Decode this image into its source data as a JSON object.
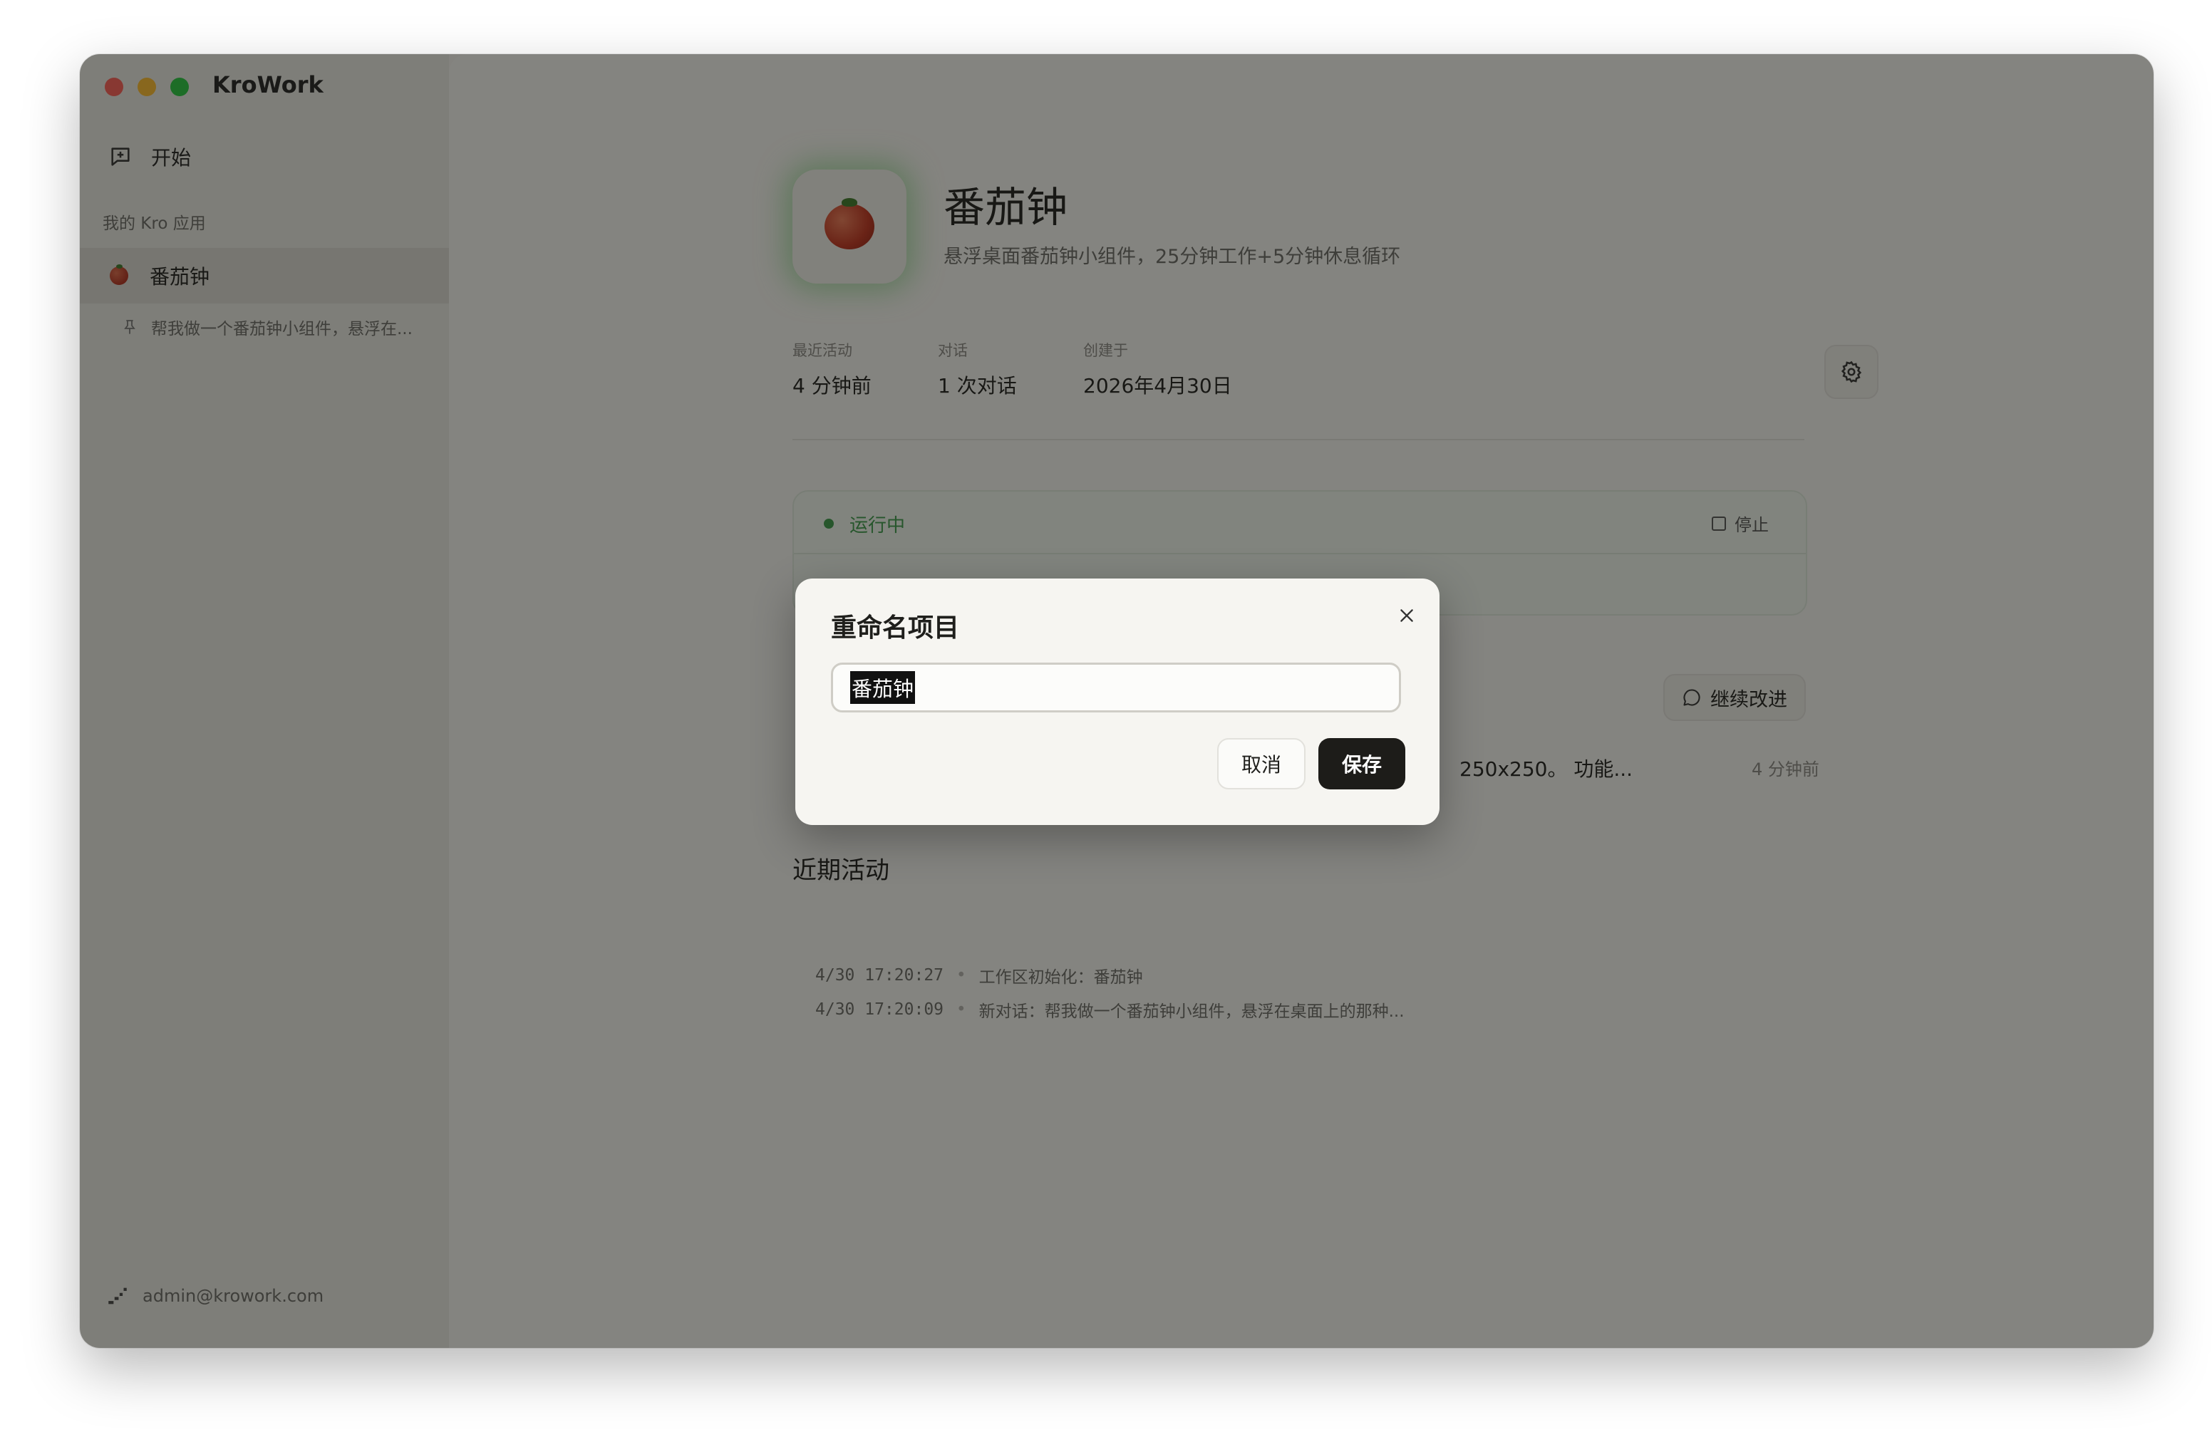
{
  "window": {
    "app_title": "KroWork"
  },
  "sidebar": {
    "start_label": "开始",
    "section_label": "我的 Kro 应用",
    "app_item_label": "番茄钟",
    "conversation_label": "帮我做一个番茄钟小组件，悬浮在...",
    "user_email": "admin@krowork.com"
  },
  "main": {
    "app_name": "番茄钟",
    "app_description": "悬浮桌面番茄钟小组件，25分钟工作+5分钟休息循环",
    "stats": [
      {
        "label": "最近活动",
        "value": "4 分钟前"
      },
      {
        "label": "对话",
        "value": "1 次对话"
      },
      {
        "label": "创建于",
        "value": "2026年4月30日"
      }
    ],
    "status_label": "运行中",
    "stop_label": "停止",
    "continue_label": "继续改进",
    "conversation_snippet": "250x250。 功能...",
    "conversation_time": "4 分钟前",
    "recent_title": "近期活动",
    "activities": [
      {
        "time": "4/30 17:20:27",
        "text": "工作区初始化：番茄钟"
      },
      {
        "time": "4/30 17:20:09",
        "text": "新对话：帮我做一个番茄钟小组件，悬浮在桌面上的那种..."
      }
    ]
  },
  "dialog": {
    "title": "重命名项目",
    "input_value": "番茄钟",
    "cancel_label": "取消",
    "save_label": "保存"
  },
  "colors": {
    "accent_dark": "#1d1c19",
    "status_green": "#3c9a4a",
    "traffic_red": "#fe5f57",
    "traffic_yellow": "#febc2e",
    "traffic_green": "#28c840"
  },
  "icons": [
    "new-chat-icon",
    "tomato-icon",
    "pin-icon",
    "user-icon",
    "gear-icon",
    "stop-icon",
    "chat-bubble-icon",
    "close-icon"
  ]
}
